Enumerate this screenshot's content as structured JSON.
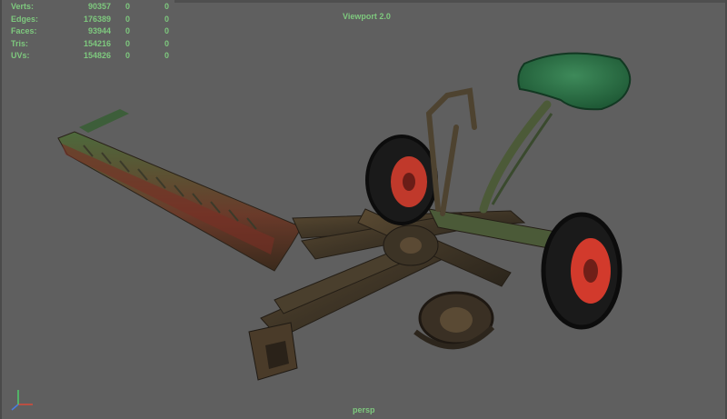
{
  "stats": [
    {
      "label": "Verts:",
      "v1": "90357",
      "v2": "0",
      "v3": "0"
    },
    {
      "label": "Edges:",
      "v1": "176389",
      "v2": "0",
      "v3": "0"
    },
    {
      "label": "Faces:",
      "v1": "93944",
      "v2": "0",
      "v3": "0"
    },
    {
      "label": "Tris:",
      "v1": "154216",
      "v2": "0",
      "v3": "0"
    },
    {
      "label": "UVs:",
      "v1": "154826",
      "v2": "0",
      "v3": "0"
    }
  ],
  "viewport_title": "Viewport 2.0",
  "camera_label": "persp",
  "colors": {
    "hud_text": "#7ec87e",
    "background": "#5f5f5f"
  },
  "icons": {
    "axis": "xyz-axis-gizmo-icon",
    "model": "sickle-bar-mower-model"
  }
}
